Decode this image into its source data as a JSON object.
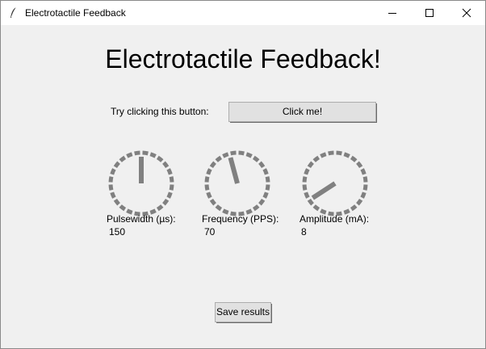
{
  "window": {
    "title": "Electrotactile Feedback",
    "app_icon": "feather-icon",
    "controls": [
      "minimize-icon",
      "maximize-icon",
      "close-icon"
    ]
  },
  "main": {
    "heading": "Electrotactile Feedback!",
    "prompt_label": "Try clicking this button:",
    "click_button_label": "Click me!",
    "save_button_label": "Save results"
  },
  "dials": [
    {
      "label": "Pulsewidth (µs):",
      "value": "150",
      "needle_angle_deg": 0
    },
    {
      "label": "Frequency (PPS):",
      "value": "70",
      "needle_angle_deg": -15
    },
    {
      "label": "Amplitude (mA):",
      "value": "8",
      "needle_angle_deg": -123
    }
  ],
  "colors": {
    "window_bg": "#f0f0f0",
    "titlebar_bg": "#ffffff",
    "dial_color": "#808080",
    "button_bg": "#e1e1e1"
  }
}
